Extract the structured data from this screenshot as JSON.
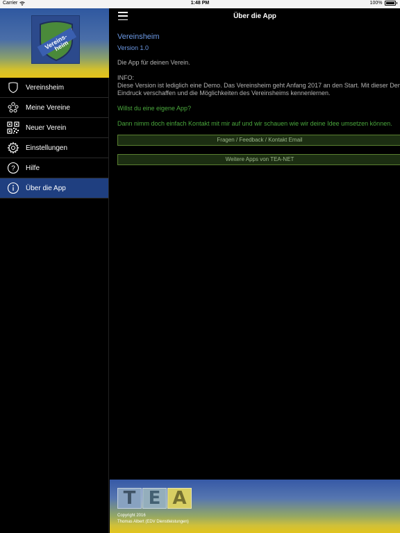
{
  "status_bar": {
    "carrier": "Carrier",
    "time": "1:48 PM",
    "battery": "100%"
  },
  "sidebar": {
    "logo_text": "Vereins-\nheim",
    "items": [
      {
        "label": "Vereinsheim",
        "icon": "shield-icon",
        "active": false
      },
      {
        "label": "Meine Vereine",
        "icon": "group-icon",
        "active": false
      },
      {
        "label": "Neuer Verein",
        "icon": "qr-code-icon",
        "active": false
      },
      {
        "label": "Einstellungen",
        "icon": "gear-icon",
        "active": false
      },
      {
        "label": "Hilfe",
        "icon": "help-icon",
        "active": false
      },
      {
        "label": "Über die App",
        "icon": "info-icon",
        "active": true
      }
    ]
  },
  "navbar": {
    "title": "Über die App",
    "menu_icon": "hamburger-icon"
  },
  "content": {
    "app_name": "Vereinsheim",
    "version": "Version 1.0",
    "tagline": "Die App für deinen Verein.",
    "info_heading": "INFO:",
    "info_line1": "Diese Version ist lediglich eine Demo. Das Vereinsheim geht Anfang 2017 an den Start. Mit dieser Demo kannst du dir einen ersten",
    "info_line2": "Eindruck verschaffen und die Möglichkeiten des Vereinsheims kennenlernen.",
    "question": "Willst du eine eigene App?",
    "contact_text": "Dann nimm doch einfach Kontakt mit mir auf und wir schauen wie wir deine Idee umsetzen können.",
    "contact_button": "Fragen / Feedback / Kontakt Email",
    "more_apps_button": "Weitere Apps von TEA-NET"
  },
  "footer": {
    "logo_letters": [
      "T",
      "E",
      "A"
    ],
    "copyright": "Copyright 2016",
    "company": "Thomas Albert (EDV Dienstleistungen)"
  },
  "colors": {
    "accent_blue": "#6d9ae6",
    "accent_green": "#4aa83d",
    "active_menu": "#1f3f80"
  }
}
